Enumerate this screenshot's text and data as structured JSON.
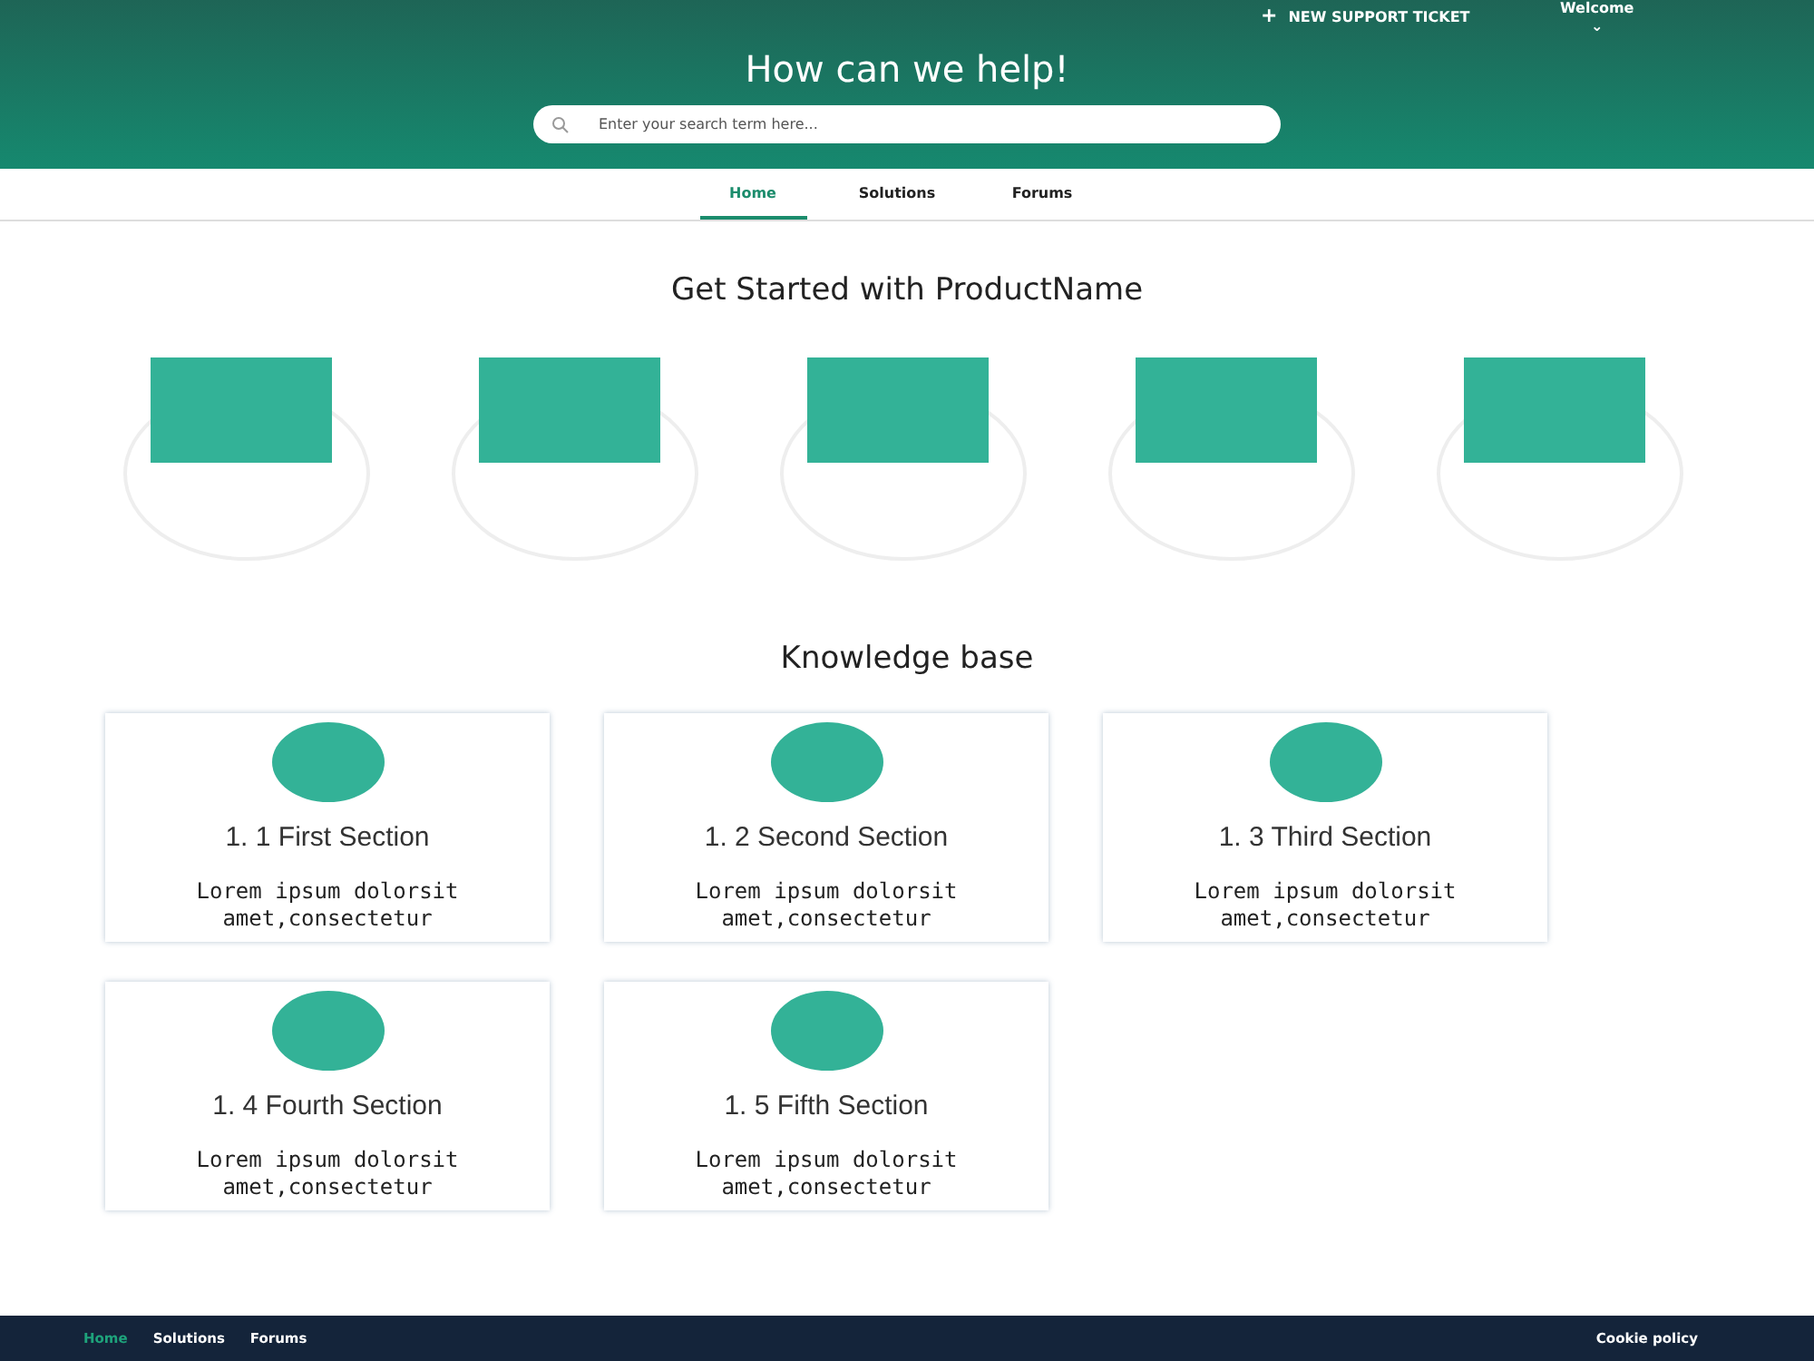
{
  "header": {
    "action": {
      "icon": "+",
      "label": "NEW SUPPORT TICKET"
    },
    "user_menu": {
      "label": "Welcome",
      "caret": "⌄"
    },
    "title": "How can we help!",
    "search": {
      "placeholder": "Enter your search term here..."
    }
  },
  "tabs": [
    {
      "label": "Home",
      "selected": true
    },
    {
      "label": "Solutions",
      "selected": false
    },
    {
      "label": "Forums",
      "selected": false
    }
  ],
  "get_started": {
    "title": "Get Started with ProductName"
  },
  "knowledge_base": {
    "title": "Knowledge base",
    "sections": [
      {
        "title": "1. 1 First Section",
        "text": "Lorem ipsum dolorsit amet,consectetur"
      },
      {
        "title": "1. 2 Second Section",
        "text": "Lorem ipsum dolorsit amet,consectetur"
      },
      {
        "title": "1. 3 Third Section",
        "text": "Lorem ipsum dolorsit amet,consectetur"
      },
      {
        "title": "1. 4 Fourth Section",
        "text": "Lorem ipsum dolorsit amet,consectetur"
      },
      {
        "title": "1. 5 Fifth Section",
        "text": "Lorem ipsum dolorsit amet,consectetur"
      }
    ]
  },
  "footer": {
    "links": [
      {
        "label": "Home",
        "selected": true
      },
      {
        "label": "Solutions",
        "selected": false
      },
      {
        "label": "Forums",
        "selected": false
      }
    ],
    "cookie_link": "Cookie policy"
  }
}
